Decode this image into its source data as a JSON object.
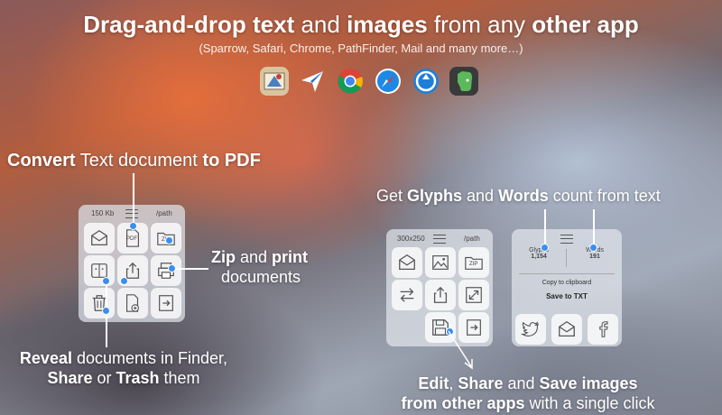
{
  "header": {
    "title_b1": "Drag-and-drop text",
    "title_n1": " and ",
    "title_b2": "images",
    "title_n2": " from any ",
    "title_b3": "other app",
    "subtitle": "(Sparrow, Safari, Chrome, PathFinder, Mail and many more…)"
  },
  "app_icons": [
    "mail-icon",
    "sparrow-icon",
    "chrome-icon",
    "safari-icon",
    "pathfinder-icon",
    "evernote-icon"
  ],
  "convert": {
    "b1": "Convert",
    "n1": " Text document ",
    "b2": "to PDF"
  },
  "zip": {
    "b1": "Zip",
    "n1": " and ",
    "b2": "print",
    "line2": "documents"
  },
  "reveal": {
    "b1": "Reveal",
    "n1": " documents in Finder,",
    "b2": "Share",
    "n2": " or ",
    "b3": "Trash",
    "n3": " them"
  },
  "glyphs_ann": {
    "n1": "Get ",
    "b1": "Glyphs",
    "n2": " and ",
    "b2": "Words",
    "n3": " count from text"
  },
  "edit_ann": {
    "b1": "Edit",
    "n1": ", ",
    "b2": "Share",
    "n2": " and ",
    "b3": "Save images",
    "b4": "from other apps",
    "n3": " with a single click"
  },
  "panel_doc": {
    "size": "150 Kb",
    "path": "/path",
    "pdf_label": "PDF",
    "zip_label": "ZIP"
  },
  "panel_img": {
    "size": "300x250",
    "path": "/path",
    "zip_label": "ZIP"
  },
  "panel_text": {
    "glyphs_label": "Glyphs",
    "glyphs_value": "1,154",
    "words_label": "Words",
    "words_value": "191",
    "copy_label": "Copy to clipboard",
    "save_label": "Save to TXT"
  },
  "colors": {
    "accent_dot": "#3a8ef0"
  }
}
